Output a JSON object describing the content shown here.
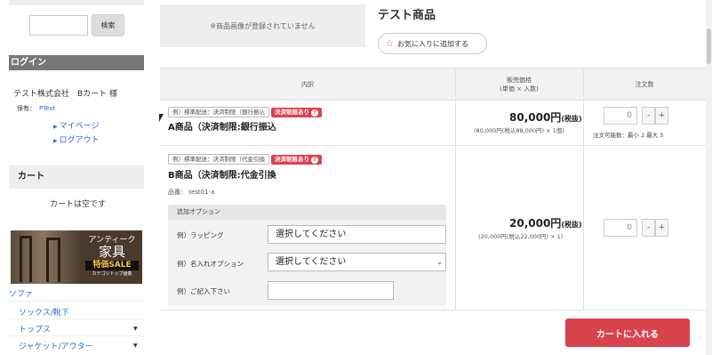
{
  "sidebar": {
    "search_button": "検索",
    "login_heading": "ログイン",
    "company_name": "テスト株式会社　Bカート 様",
    "points_label": "保有：",
    "points_value": "PTest",
    "links": [
      "マイページ",
      "ログアウト"
    ],
    "cart_heading": "カート",
    "cart_empty": "カートは空です",
    "banner": {
      "line1": "アンティーク",
      "line2": "家具",
      "line3": "特価SALE",
      "line4": "カテゴリトップ画像"
    },
    "categories": [
      "ソファ",
      "ソックス/靴下",
      "トップス",
      "ジャケット/アウター"
    ]
  },
  "product": {
    "no_image_text": "※商品画像が登録されていません",
    "title": "テスト商品",
    "favorite_label": "お気に入りに追加する"
  },
  "table": {
    "headers": {
      "detail": "内訳",
      "price_line1": "販売価格",
      "price_line2": "(単価 × 入数)",
      "qty": "注文数"
    },
    "rows": [
      {
        "tag": "例）標準配送：決済制限（銀行振込",
        "restriction": "決済制限あり",
        "name": "A商品（決済制限:銀行振込",
        "price": "80,000円",
        "tax": "(税抜)",
        "price_sub": "(80,000円(税込88,000円) × 1個)",
        "qty": "0",
        "qty_note": "注文可能数：最小 2  最大 5"
      },
      {
        "tag": "例）標準配送：決済制限（代金引換",
        "restriction": "決済制限あり",
        "name": "B商品（決済制限:代金引換",
        "code": "品番： test01-a",
        "price": "20,000円",
        "tax": "(税抜)",
        "price_sub": "(20,000円(税込22,000円) × 1)",
        "qty": "0"
      }
    ],
    "options": {
      "heading": "追加オプション",
      "items": [
        {
          "label": "例）ラッピング",
          "value": "選択してください"
        },
        {
          "label": "例）名入れオプション",
          "value": "選択してください"
        },
        {
          "label": "例）ご記入下さい",
          "value": ""
        }
      ]
    }
  },
  "add_to_cart": "カートに入れる",
  "colors": {
    "accent": "#d9434e",
    "link": "#2a6fc9"
  }
}
